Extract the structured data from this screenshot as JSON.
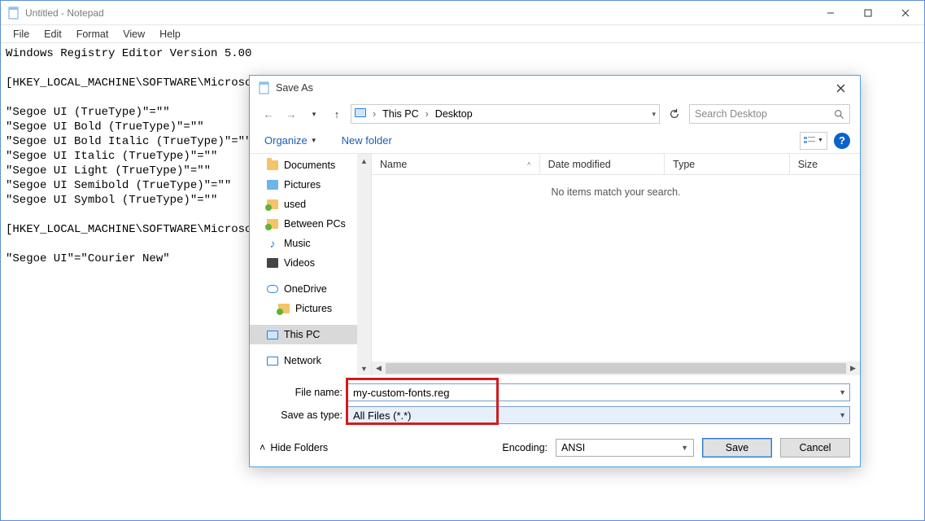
{
  "notepad": {
    "title": "Untitled - Notepad",
    "menu": {
      "file": "File",
      "edit": "Edit",
      "format": "Format",
      "view": "View",
      "help": "Help"
    },
    "content": "Windows Registry Editor Version 5.00\n\n[HKEY_LOCAL_MACHINE\\SOFTWARE\\Microsof\n\n\"Segoe UI (TrueType)\"=\"\"\n\"Segoe UI Bold (TrueType)\"=\"\"\n\"Segoe UI Bold Italic (TrueType)\"=\"\"\n\"Segoe UI Italic (TrueType)\"=\"\"\n\"Segoe UI Light (TrueType)\"=\"\"\n\"Segoe UI Semibold (TrueType)\"=\"\"\n\"Segoe UI Symbol (TrueType)\"=\"\"\n\n[HKEY_LOCAL_MACHINE\\SOFTWARE\\Microsof\n\n\"Segoe UI\"=\"Courier New\""
  },
  "dialog": {
    "title": "Save As",
    "breadcrumb": {
      "root_sep": "›",
      "p1": "This PC",
      "p2": "Desktop"
    },
    "search_placeholder": "Search Desktop",
    "organize": "Organize",
    "new_folder": "New folder",
    "columns": {
      "name": "Name",
      "date": "Date modified",
      "type": "Type",
      "size": "Size"
    },
    "empty_msg": "No items match your search.",
    "tree": {
      "documents": "Documents",
      "pictures_q": "Pictures",
      "used": "used",
      "between": "Between PCs",
      "music": "Music",
      "videos": "Videos",
      "onedrive": "OneDrive",
      "pictures_od": "Pictures",
      "thispc": "This PC",
      "network": "Network"
    },
    "filename_label": "File name:",
    "filename_value": "my-custom-fonts.reg",
    "savetype_label": "Save as type:",
    "savetype_value": "All Files  (*.*)",
    "hide_folders": "Hide Folders",
    "encoding_label": "Encoding:",
    "encoding_value": "ANSI",
    "save": "Save",
    "cancel": "Cancel"
  }
}
